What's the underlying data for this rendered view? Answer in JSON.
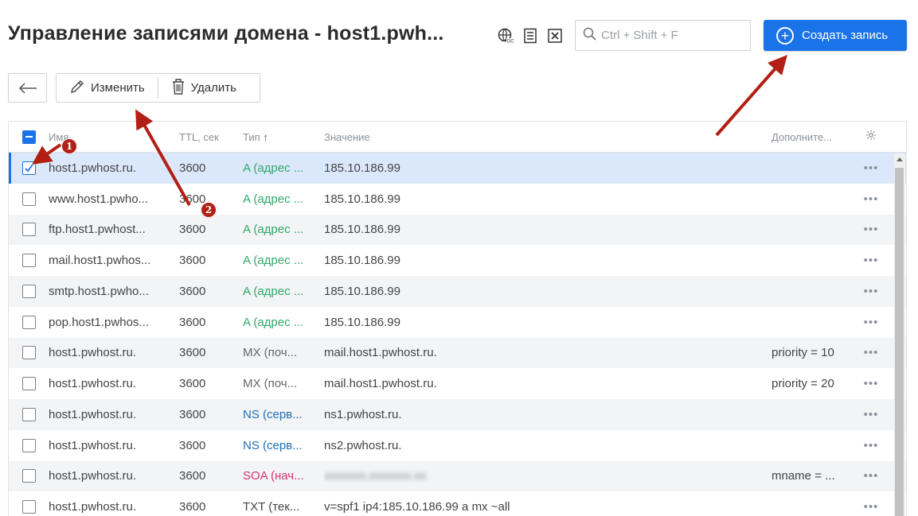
{
  "header": {
    "title": "Управление записями домена - host1.pwh...",
    "icons": [
      "globe-icon",
      "list-icon",
      "excel-icon"
    ]
  },
  "search": {
    "placeholder": "Ctrl + Shift + F",
    "value": ""
  },
  "create_button": {
    "label": "Создать запись"
  },
  "toolbar": {
    "edit_label": "Изменить",
    "delete_label": "Удалить"
  },
  "table": {
    "columns": {
      "name": "Имя",
      "ttl": "TTL, сек",
      "type": "Тип",
      "value": "Значение",
      "extra": "Дополните..."
    },
    "sort_indicator": "↑",
    "rows": [
      {
        "name": "host1.pwhost.ru.",
        "ttl": "3600",
        "type": "A (адрес ...",
        "value": "185.10.186.99",
        "extra": "",
        "selected": true
      },
      {
        "name": "www.host1.pwho...",
        "ttl": "3600",
        "type": "A (адрес ...",
        "value": "185.10.186.99",
        "extra": ""
      },
      {
        "name": "ftp.host1.pwhost...",
        "ttl": "3600",
        "type": "A (адрес ...",
        "value": "185.10.186.99",
        "extra": ""
      },
      {
        "name": "mail.host1.pwhos...",
        "ttl": "3600",
        "type": "A (адрес ...",
        "value": "185.10.186.99",
        "extra": ""
      },
      {
        "name": "smtp.host1.pwho...",
        "ttl": "3600",
        "type": "A (адрес ...",
        "value": "185.10.186.99",
        "extra": ""
      },
      {
        "name": "pop.host1.pwhos...",
        "ttl": "3600",
        "type": "A (адрес ...",
        "value": "185.10.186.99",
        "extra": ""
      },
      {
        "name": "host1.pwhost.ru.",
        "ttl": "3600",
        "type": "MX (поч...",
        "value": "mail.host1.pwhost.ru.",
        "extra": "priority = 10"
      },
      {
        "name": "host1.pwhost.ru.",
        "ttl": "3600",
        "type": "MX (поч...",
        "value": "mail.host1.pwhost.ru.",
        "extra": "priority = 20"
      },
      {
        "name": "host1.pwhost.ru.",
        "ttl": "3600",
        "type": "NS (серв...",
        "value": "ns1.pwhost.ru.",
        "extra": ""
      },
      {
        "name": "host1.pwhost.ru.",
        "ttl": "3600",
        "type": "NS (серв...",
        "value": "ns2.pwhost.ru.",
        "extra": ""
      },
      {
        "name": "host1.pwhost.ru.",
        "ttl": "3600",
        "type": "SOA (нач...",
        "value": "",
        "extra": "mname = ...",
        "blurred_value": true
      },
      {
        "name": "host1.pwhost.ru.",
        "ttl": "3600",
        "type": "TXT (тек...",
        "value": "v=spf1 ip4:185.10.186.99 a mx ~all",
        "extra": ""
      }
    ]
  },
  "annotations": {
    "badge_1": "1",
    "badge_2": "2"
  },
  "colors": {
    "accent": "#1a73e8",
    "annotation": "#b21f14",
    "type_a": "#2eaa6a",
    "type_ns": "#1f6fb8",
    "type_soa": "#d6336c"
  }
}
